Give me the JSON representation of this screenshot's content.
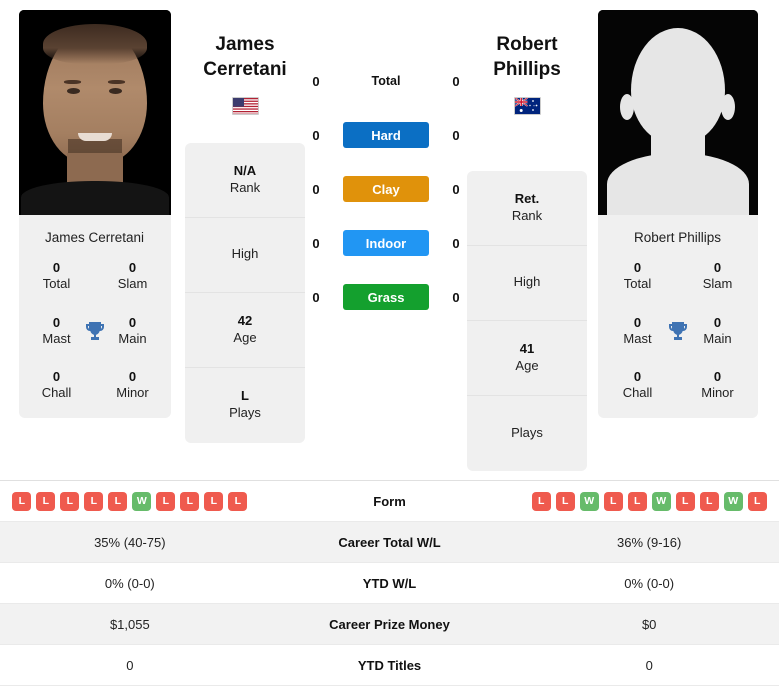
{
  "players": {
    "left": {
      "name_line1": "James",
      "name_line2": "Cerretani",
      "full_name": "James Cerretani",
      "flag": "us-flag-icon",
      "flag_country": "United States",
      "photo": "player-photo",
      "rank_value": "N/A",
      "rank_label": "Rank",
      "high_value": "",
      "high_label": "High",
      "age_value": "42",
      "age_label": "Age",
      "plays_value": "L",
      "plays_label": "Plays",
      "titles": {
        "total_value": "0",
        "total_label": "Total",
        "slam_value": "0",
        "slam_label": "Slam",
        "mast_value": "0",
        "mast_label": "Mast",
        "main_value": "0",
        "main_label": "Main",
        "chall_value": "0",
        "chall_label": "Chall",
        "minor_value": "0",
        "minor_label": "Minor"
      },
      "form": [
        "L",
        "L",
        "L",
        "L",
        "L",
        "W",
        "L",
        "L",
        "L",
        "L"
      ],
      "career_total_wl": "35% (40-75)",
      "ytd_wl": "0% (0-0)",
      "career_prize_money": "$1,055",
      "ytd_titles": "0",
      "surface_scores": {
        "total": "0",
        "hard": "0",
        "clay": "0",
        "indoor": "0",
        "grass": "0"
      }
    },
    "right": {
      "name_line1": "Robert",
      "name_line2": "Phillips",
      "full_name": "Robert Phillips",
      "flag": "au-flag-icon",
      "flag_country": "Australia",
      "photo": "player-photo-placeholder",
      "rank_value": "Ret.",
      "rank_label": "Rank",
      "high_value": "",
      "high_label": "High",
      "age_value": "41",
      "age_label": "Age",
      "plays_value": "",
      "plays_label": "Plays",
      "titles": {
        "total_value": "0",
        "total_label": "Total",
        "slam_value": "0",
        "slam_label": "Slam",
        "mast_value": "0",
        "mast_label": "Mast",
        "main_value": "0",
        "main_label": "Main",
        "chall_value": "0",
        "chall_label": "Chall",
        "minor_value": "0",
        "minor_label": "Minor"
      },
      "form": [
        "L",
        "L",
        "W",
        "L",
        "L",
        "W",
        "L",
        "L",
        "W",
        "L"
      ],
      "career_total_wl": "36% (9-16)",
      "ytd_wl": "0% (0-0)",
      "career_prize_money": "$0",
      "ytd_titles": "0",
      "surface_scores": {
        "total": "0",
        "hard": "0",
        "clay": "0",
        "indoor": "0",
        "grass": "0"
      }
    }
  },
  "surfaces": [
    {
      "key": "total",
      "label": "Total",
      "color": "transparent",
      "text_color": "#111111"
    },
    {
      "key": "hard",
      "label": "Hard",
      "color": "#0b6fc4",
      "text_color": "#ffffff"
    },
    {
      "key": "clay",
      "label": "Clay",
      "color": "#e0920b",
      "text_color": "#ffffff"
    },
    {
      "key": "indoor",
      "label": "Indoor",
      "color": "#2196f3",
      "text_color": "#ffffff"
    },
    {
      "key": "grass",
      "label": "Grass",
      "color": "#14a02e",
      "text_color": "#ffffff"
    }
  ],
  "table": {
    "rows": [
      {
        "label": "Form",
        "type": "form"
      },
      {
        "label": "Career Total W/L",
        "type": "text",
        "left": "35% (40-75)",
        "right": "36% (9-16)"
      },
      {
        "label": "YTD W/L",
        "type": "text",
        "left": "0% (0-0)",
        "right": "0% (0-0)"
      },
      {
        "label": "Career Prize Money",
        "type": "text",
        "left": "$1,055",
        "right": "$0"
      },
      {
        "label": "YTD Titles",
        "type": "text",
        "left": "0",
        "right": "0"
      }
    ]
  },
  "colors": {
    "win": "#66bb6a",
    "loss": "#ef5a4e",
    "card_bg": "#f0f0f0",
    "row_shade": "#f2f2f2",
    "trophy": "#3f73b3"
  },
  "icons": {
    "trophy": "trophy-icon"
  }
}
